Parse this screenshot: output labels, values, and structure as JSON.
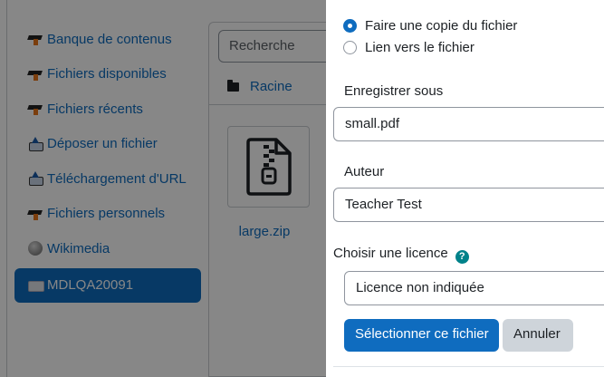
{
  "sidebar": {
    "items": [
      {
        "label": "Banque de contenus",
        "icon": "moodle-icon"
      },
      {
        "label": "Fichiers disponibles",
        "icon": "moodle-icon"
      },
      {
        "label": "Fichiers récents",
        "icon": "moodle-icon"
      },
      {
        "label": "Déposer un fichier",
        "icon": "upload-icon"
      },
      {
        "label": "Téléchargement d'URL",
        "icon": "upload-icon"
      },
      {
        "label": "Fichiers personnels",
        "icon": "moodle-icon"
      },
      {
        "label": "Wikimedia",
        "icon": "globe-icon"
      },
      {
        "label": "MDLQA20091",
        "icon": "server-icon",
        "active": true
      }
    ]
  },
  "browser": {
    "search_placeholder": "Recherche",
    "breadcrumb": "Racine",
    "files": [
      {
        "name": "large.zip",
        "icon": "zip-file-icon"
      }
    ]
  },
  "dialog": {
    "options": [
      {
        "label": "Faire une copie du fichier",
        "checked": true
      },
      {
        "label": "Lien vers le fichier",
        "checked": false
      }
    ],
    "save_as_label": "Enregistrer sous",
    "save_as_value": "small.pdf",
    "author_label": "Auteur",
    "author_value": "Teacher Test",
    "license_label": "Choisir une licence",
    "license_help": "?",
    "license_value": "Licence non indiquée",
    "select_button": "Sélectionner ce fichier",
    "cancel_button": "Annuler"
  },
  "colors": {
    "primary": "#0f6cbf",
    "secondary_button": "#ced4da",
    "help_badge": "#00828a",
    "overlay": "rgba(0,0,0,0.47)"
  }
}
